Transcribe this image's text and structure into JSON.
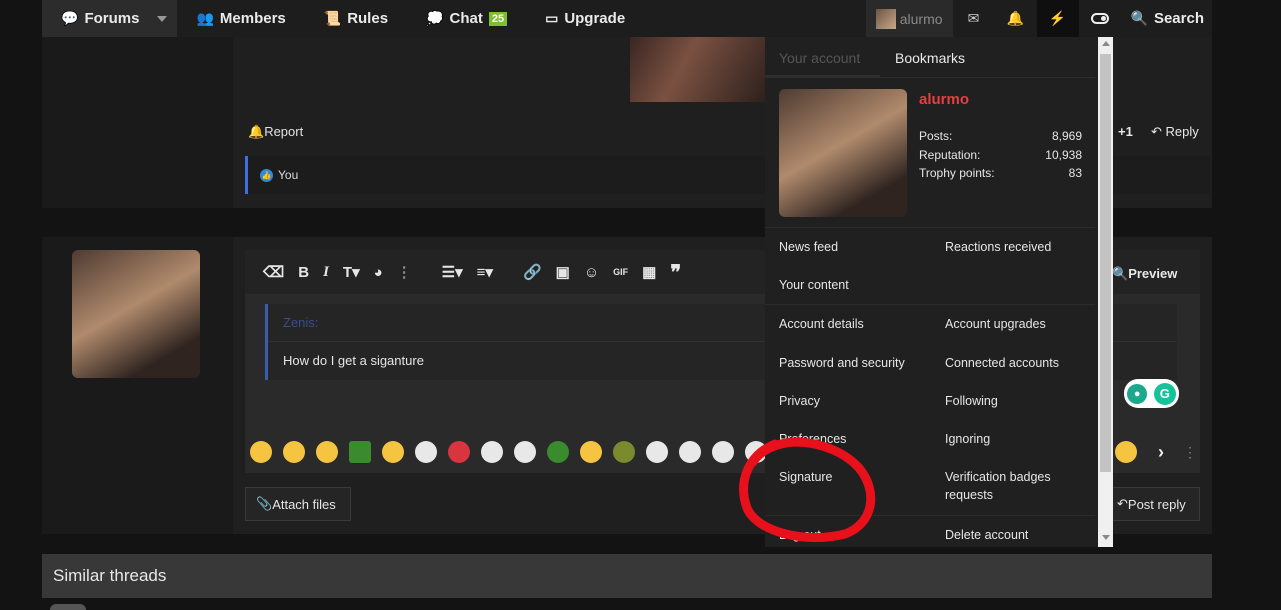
{
  "nav": {
    "forums": "Forums",
    "members": "Members",
    "rules": "Rules",
    "chat": "Chat",
    "chat_badge": "25",
    "upgrade": "Upgrade",
    "username": "alurmo",
    "search": "Search"
  },
  "post": {
    "report": "Report",
    "plus_one": "+1",
    "reply": "Reply",
    "reaction_user": "You"
  },
  "editor": {
    "preview": "Preview",
    "quote_author": "Zenis:",
    "quote_text": "How do I get a siganture",
    "attach": "Attach files",
    "post_reply": "Post reply"
  },
  "similar": {
    "title": "Similar threads"
  },
  "menu": {
    "tab_account": "Your account",
    "tab_bookmarks": "Bookmarks",
    "username": "alurmo",
    "stats": [
      {
        "label": "Posts:",
        "value": "8,969"
      },
      {
        "label": "Reputation:",
        "value": "10,938"
      },
      {
        "label": "Trophy points:",
        "value": "83"
      }
    ],
    "links": {
      "news_feed": "News feed",
      "reactions_received": "Reactions received",
      "your_content": "Your content",
      "account_details": "Account details",
      "account_upgrades": "Account upgrades",
      "password_security": "Password and security",
      "connected_accounts": "Connected accounts",
      "privacy": "Privacy",
      "following": "Following",
      "preferences": "Preferences",
      "ignoring": "Ignoring",
      "signature": "Signature",
      "verification_badges": "Verification badges requests",
      "log_out": "Log out",
      "delete_account": "Delete account"
    }
  },
  "colors": {
    "accent_red": "#e53f3f",
    "annotation": "#e8101a",
    "chat_badge": "#7fbf2c"
  }
}
